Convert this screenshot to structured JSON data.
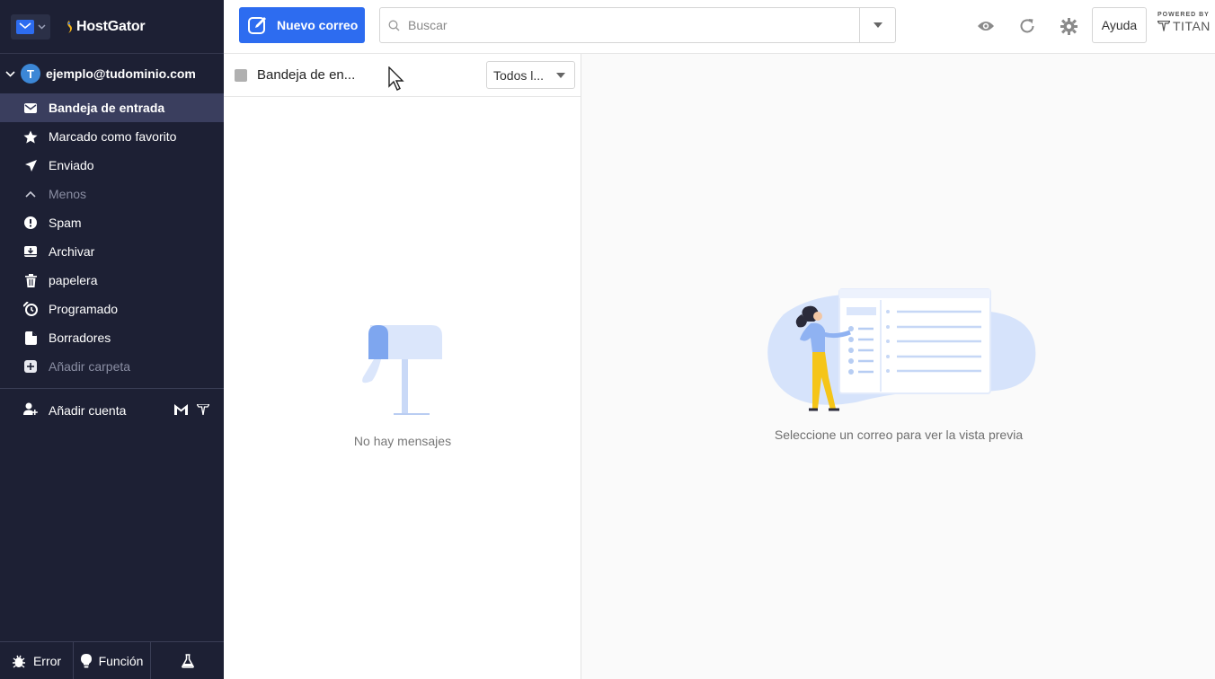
{
  "brand": {
    "name": "HostGator"
  },
  "account": {
    "email": "ejemplo@tudominio.com",
    "initial": "T"
  },
  "folders": [
    {
      "label": "Bandeja de entrada",
      "icon": "envelope-icon",
      "active": true
    },
    {
      "label": "Marcado como favorito",
      "icon": "star-icon"
    },
    {
      "label": "Enviado",
      "icon": "paper-plane-icon"
    },
    {
      "label": "Menos",
      "icon": "chevron-up-icon",
      "muted": true
    },
    {
      "label": "Spam",
      "icon": "alert-icon"
    },
    {
      "label": "Archivar",
      "icon": "archive-icon"
    },
    {
      "label": "papelera",
      "icon": "trash-icon"
    },
    {
      "label": "Programado",
      "icon": "clock-icon"
    },
    {
      "label": "Borradores",
      "icon": "draft-icon"
    },
    {
      "label": "Añadir carpeta",
      "icon": "plus-circle-icon",
      "muted": true
    }
  ],
  "add_account": {
    "label": "Añadir cuenta"
  },
  "bottom": {
    "error": "Error",
    "feature": "Función"
  },
  "header": {
    "compose": "Nuevo correo",
    "search_placeholder": "Buscar",
    "help": "Ayuda",
    "powered_by": "POWERED BY",
    "titan": "TITAN"
  },
  "list": {
    "title": "Bandeja de en...",
    "filter": "Todos l...",
    "empty": "No hay mensajes"
  },
  "preview": {
    "empty": "Seleccione un correo para ver la vista previa"
  },
  "colors": {
    "sidebar": "#1d2034",
    "accent": "#2d6cf0",
    "active_item": "#3a3e5e"
  }
}
